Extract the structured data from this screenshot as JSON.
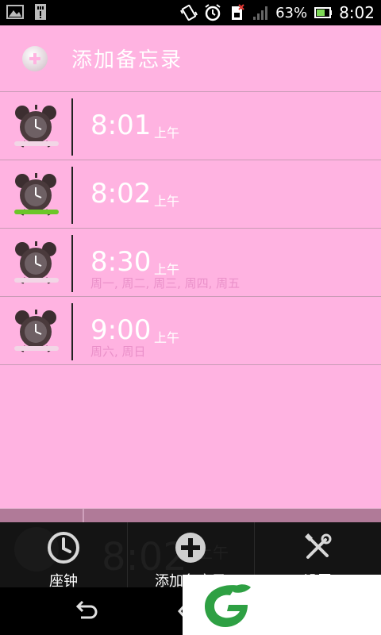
{
  "status_bar": {
    "battery_percent": "63%",
    "time": "8:02",
    "icons": [
      "gallery-icon",
      "sd-card-icon",
      "vibrate-icon",
      "alarm-clock-icon",
      "sim-missing-icon",
      "signal-icon",
      "battery-icon"
    ]
  },
  "add_memo": {
    "label": "添加备忘录",
    "icon": "add-circle-icon"
  },
  "alarms": [
    {
      "time": "8:01",
      "ampm": "上午",
      "days": "",
      "enabled": false
    },
    {
      "time": "8:02",
      "ampm": "上午",
      "days": "",
      "enabled": true
    },
    {
      "time": "8:30",
      "ampm": "上午",
      "days": "周一, 周二, 周三, 周四, 周五",
      "enabled": false
    },
    {
      "time": "9:00",
      "ampm": "上午",
      "days": "周六, 周日",
      "enabled": false
    }
  ],
  "action_bar": {
    "items": [
      {
        "label": "座钟",
        "icon": "clock-icon"
      },
      {
        "label": "添加备忘录",
        "icon": "plus-circle-icon"
      },
      {
        "label": "设置",
        "icon": "tools-icon"
      }
    ],
    "background_time": "8:02",
    "background_ampm": "上午"
  },
  "colors": {
    "pink_background": "#ffb3e1",
    "enabled_indicator": "#6cc628",
    "action_bar": "#141414",
    "logo_green": "#2ea043"
  }
}
